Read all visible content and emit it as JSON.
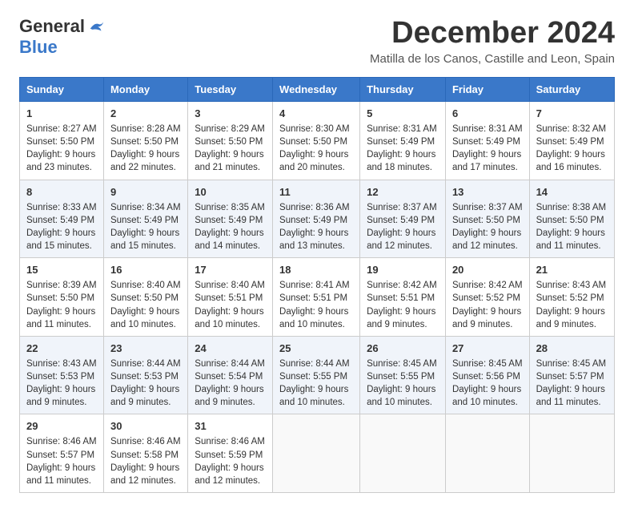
{
  "header": {
    "logo_general": "General",
    "logo_blue": "Blue",
    "month": "December 2024",
    "location": "Matilla de los Canos, Castille and Leon, Spain"
  },
  "calendar": {
    "days_of_week": [
      "Sunday",
      "Monday",
      "Tuesday",
      "Wednesday",
      "Thursday",
      "Friday",
      "Saturday"
    ],
    "weeks": [
      [
        {
          "day": "",
          "empty": true
        },
        {
          "day": "",
          "empty": true
        },
        {
          "day": "",
          "empty": true
        },
        {
          "day": "",
          "empty": true
        },
        {
          "day": "",
          "empty": true
        },
        {
          "day": "",
          "empty": true
        },
        {
          "day": "",
          "empty": true
        }
      ],
      [
        {
          "day": "1",
          "sunrise": "Sunrise: 8:27 AM",
          "sunset": "Sunset: 5:50 PM",
          "daylight": "Daylight: 9 hours and 23 minutes."
        },
        {
          "day": "2",
          "sunrise": "Sunrise: 8:28 AM",
          "sunset": "Sunset: 5:50 PM",
          "daylight": "Daylight: 9 hours and 22 minutes."
        },
        {
          "day": "3",
          "sunrise": "Sunrise: 8:29 AM",
          "sunset": "Sunset: 5:50 PM",
          "daylight": "Daylight: 9 hours and 21 minutes."
        },
        {
          "day": "4",
          "sunrise": "Sunrise: 8:30 AM",
          "sunset": "Sunset: 5:50 PM",
          "daylight": "Daylight: 9 hours and 20 minutes."
        },
        {
          "day": "5",
          "sunrise": "Sunrise: 8:31 AM",
          "sunset": "Sunset: 5:49 PM",
          "daylight": "Daylight: 9 hours and 18 minutes."
        },
        {
          "day": "6",
          "sunrise": "Sunrise: 8:31 AM",
          "sunset": "Sunset: 5:49 PM",
          "daylight": "Daylight: 9 hours and 17 minutes."
        },
        {
          "day": "7",
          "sunrise": "Sunrise: 8:32 AM",
          "sunset": "Sunset: 5:49 PM",
          "daylight": "Daylight: 9 hours and 16 minutes."
        }
      ],
      [
        {
          "day": "8",
          "sunrise": "Sunrise: 8:33 AM",
          "sunset": "Sunset: 5:49 PM",
          "daylight": "Daylight: 9 hours and 15 minutes."
        },
        {
          "day": "9",
          "sunrise": "Sunrise: 8:34 AM",
          "sunset": "Sunset: 5:49 PM",
          "daylight": "Daylight: 9 hours and 15 minutes."
        },
        {
          "day": "10",
          "sunrise": "Sunrise: 8:35 AM",
          "sunset": "Sunset: 5:49 PM",
          "daylight": "Daylight: 9 hours and 14 minutes."
        },
        {
          "day": "11",
          "sunrise": "Sunrise: 8:36 AM",
          "sunset": "Sunset: 5:49 PM",
          "daylight": "Daylight: 9 hours and 13 minutes."
        },
        {
          "day": "12",
          "sunrise": "Sunrise: 8:37 AM",
          "sunset": "Sunset: 5:49 PM",
          "daylight": "Daylight: 9 hours and 12 minutes."
        },
        {
          "day": "13",
          "sunrise": "Sunrise: 8:37 AM",
          "sunset": "Sunset: 5:50 PM",
          "daylight": "Daylight: 9 hours and 12 minutes."
        },
        {
          "day": "14",
          "sunrise": "Sunrise: 8:38 AM",
          "sunset": "Sunset: 5:50 PM",
          "daylight": "Daylight: 9 hours and 11 minutes."
        }
      ],
      [
        {
          "day": "15",
          "sunrise": "Sunrise: 8:39 AM",
          "sunset": "Sunset: 5:50 PM",
          "daylight": "Daylight: 9 hours and 11 minutes."
        },
        {
          "day": "16",
          "sunrise": "Sunrise: 8:40 AM",
          "sunset": "Sunset: 5:50 PM",
          "daylight": "Daylight: 9 hours and 10 minutes."
        },
        {
          "day": "17",
          "sunrise": "Sunrise: 8:40 AM",
          "sunset": "Sunset: 5:51 PM",
          "daylight": "Daylight: 9 hours and 10 minutes."
        },
        {
          "day": "18",
          "sunrise": "Sunrise: 8:41 AM",
          "sunset": "Sunset: 5:51 PM",
          "daylight": "Daylight: 9 hours and 10 minutes."
        },
        {
          "day": "19",
          "sunrise": "Sunrise: 8:42 AM",
          "sunset": "Sunset: 5:51 PM",
          "daylight": "Daylight: 9 hours and 9 minutes."
        },
        {
          "day": "20",
          "sunrise": "Sunrise: 8:42 AM",
          "sunset": "Sunset: 5:52 PM",
          "daylight": "Daylight: 9 hours and 9 minutes."
        },
        {
          "day": "21",
          "sunrise": "Sunrise: 8:43 AM",
          "sunset": "Sunset: 5:52 PM",
          "daylight": "Daylight: 9 hours and 9 minutes."
        }
      ],
      [
        {
          "day": "22",
          "sunrise": "Sunrise: 8:43 AM",
          "sunset": "Sunset: 5:53 PM",
          "daylight": "Daylight: 9 hours and 9 minutes."
        },
        {
          "day": "23",
          "sunrise": "Sunrise: 8:44 AM",
          "sunset": "Sunset: 5:53 PM",
          "daylight": "Daylight: 9 hours and 9 minutes."
        },
        {
          "day": "24",
          "sunrise": "Sunrise: 8:44 AM",
          "sunset": "Sunset: 5:54 PM",
          "daylight": "Daylight: 9 hours and 9 minutes."
        },
        {
          "day": "25",
          "sunrise": "Sunrise: 8:44 AM",
          "sunset": "Sunset: 5:55 PM",
          "daylight": "Daylight: 9 hours and 10 minutes."
        },
        {
          "day": "26",
          "sunrise": "Sunrise: 8:45 AM",
          "sunset": "Sunset: 5:55 PM",
          "daylight": "Daylight: 9 hours and 10 minutes."
        },
        {
          "day": "27",
          "sunrise": "Sunrise: 8:45 AM",
          "sunset": "Sunset: 5:56 PM",
          "daylight": "Daylight: 9 hours and 10 minutes."
        },
        {
          "day": "28",
          "sunrise": "Sunrise: 8:45 AM",
          "sunset": "Sunset: 5:57 PM",
          "daylight": "Daylight: 9 hours and 11 minutes."
        }
      ],
      [
        {
          "day": "29",
          "sunrise": "Sunrise: 8:46 AM",
          "sunset": "Sunset: 5:57 PM",
          "daylight": "Daylight: 9 hours and 11 minutes."
        },
        {
          "day": "30",
          "sunrise": "Sunrise: 8:46 AM",
          "sunset": "Sunset: 5:58 PM",
          "daylight": "Daylight: 9 hours and 12 minutes."
        },
        {
          "day": "31",
          "sunrise": "Sunrise: 8:46 AM",
          "sunset": "Sunset: 5:59 PM",
          "daylight": "Daylight: 9 hours and 12 minutes."
        },
        {
          "day": "",
          "empty": true
        },
        {
          "day": "",
          "empty": true
        },
        {
          "day": "",
          "empty": true
        },
        {
          "day": "",
          "empty": true
        }
      ]
    ]
  }
}
